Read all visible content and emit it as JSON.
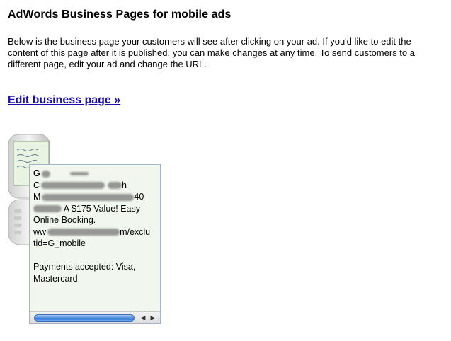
{
  "header": {
    "title": "AdWords Business Pages for mobile ads"
  },
  "description": "Below is the business page your customers will see after clicking on your ad. If you'd like to edit the content of this page after it is published, you can make changes at any time. To send customers to a different page, edit your ad and change the URL.",
  "edit_link": "Edit business page  »",
  "preview": {
    "line1": "G",
    "line2_prefix": "C",
    "line2_suffix": "h",
    "line3_prefix": "M",
    "line3_suffix": "40",
    "line4": "A $175 Value! Easy",
    "line5": "Online Booking.",
    "line6_prefix": "ww",
    "line6_suffix": "m/exclu",
    "line7": "tid=G_mobile",
    "payments_line1": "Payments accepted: Visa,",
    "payments_line2": "Mastercard"
  },
  "scrollbar": {
    "left_arrow": "◀",
    "right_arrow": "▶"
  }
}
